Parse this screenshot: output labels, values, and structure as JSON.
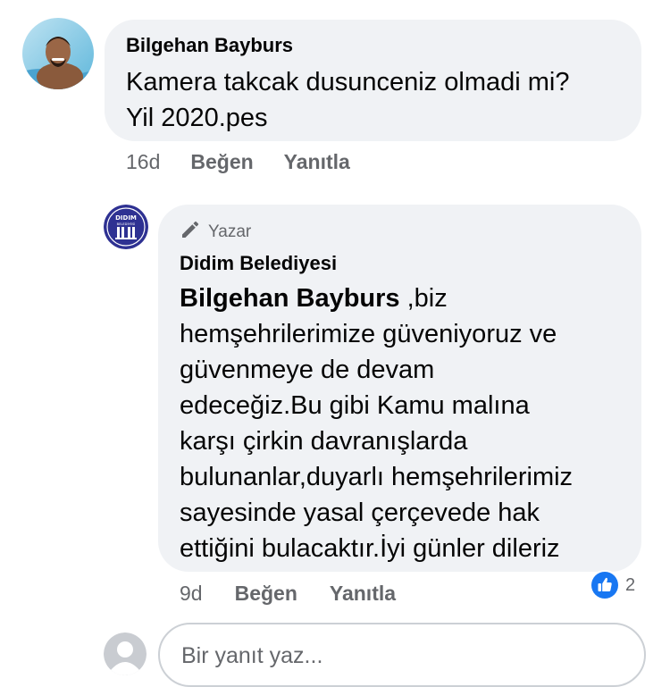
{
  "comment": {
    "author": "Bilgehan Bayburs",
    "lines": [
      "Kamera takcak dusunceniz olmadi mi?",
      "Yil 2020.pes"
    ],
    "time": "16d",
    "like_label": "Beğen",
    "reply_label": "Yanıtla"
  },
  "reply": {
    "badge_label": "Yazar",
    "author": "Didim Belediyesi",
    "avatar_text": "DIDIM",
    "avatar_subtext": "BELEDİYESİ",
    "mention": "Bilgehan Bayburs",
    "text_first": " ,biz",
    "lines": [
      "hemşehrilerimize güveniyoruz ve",
      "güvenmeye de devam",
      "edeceğiz.Bu gibi Kamu malına",
      "karşı çirkin davranışlarda",
      "bulunanlar,duyarlı hemşehrilerimiz",
      "sayesinde yasal çerçevede hak",
      "ettiğini bulacaktır.İyi günler dileriz"
    ],
    "time": "9d",
    "like_label": "Beğen",
    "reply_label": "Yanıtla",
    "reaction_icon": "like-icon",
    "reaction_count": "2"
  },
  "composer": {
    "placeholder": "Bir yanıt yaz..."
  },
  "colors": {
    "bubble": "#f0f2f5",
    "secondary_text": "#65676b",
    "like_blue": "#1877f2",
    "page_avatar_blue": "#2e3192"
  }
}
